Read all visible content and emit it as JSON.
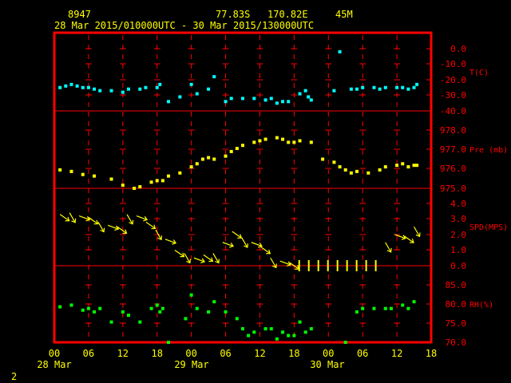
{
  "header": {
    "station": "8947",
    "lat": "77.83S",
    "lon": "170.82E",
    "elev": "45M",
    "period": "28 Mar 2015/010000UTC - 30 Mar 2015/130000UTC"
  },
  "footer": {
    "page_number": "2"
  },
  "colors": {
    "frame": "#ff0000",
    "axis_text": "#ff0000",
    "title_text": "#ffff00",
    "temperature": "#00ffff",
    "pressure": "#ffff00",
    "wind": "#ffff00",
    "humidity": "#00ff00",
    "x_labels": "#ffff00"
  },
  "chart_data": {
    "type": "scatter",
    "x_axis": {
      "tick_labels": [
        "00",
        "06",
        "12",
        "18",
        "00",
        "06",
        "12",
        "18",
        "00",
        "06",
        "12",
        "18"
      ],
      "day_labels": [
        "28 Mar",
        "29 Mar",
        "30 Mar"
      ],
      "range_hours": [
        0,
        66
      ]
    },
    "panels": [
      {
        "id": "temperature",
        "label": "T(C)",
        "tick_labels": [
          "0.0",
          "-10.0",
          "-20.0",
          "-30.0",
          "-40.0"
        ],
        "ylim": [
          -40,
          0
        ],
        "series": {
          "x": [
            1,
            2,
            3,
            4,
            5,
            6,
            7,
            8,
            10,
            12,
            13,
            15,
            16,
            18,
            18.5,
            20,
            22,
            24,
            25,
            27,
            28,
            30,
            31,
            33,
            35,
            37,
            38,
            39,
            40,
            41,
            43,
            44,
            44.5,
            45,
            49,
            50,
            52,
            53,
            54,
            56,
            57,
            58,
            60,
            61,
            62,
            63,
            63.5
          ],
          "y": [
            -25,
            -24,
            -23,
            -24,
            -25,
            -25,
            -26,
            -27,
            -27,
            -28,
            -26,
            -26,
            -25,
            -25,
            -23,
            -34,
            -31,
            -23,
            -29,
            -26,
            -18,
            -34,
            -32,
            -32,
            -32,
            -33,
            -32,
            -35,
            -34,
            -34,
            -29,
            -27,
            -31,
            -33,
            -27,
            -2,
            -26,
            -26,
            -25,
            -25,
            -26,
            -25,
            -25,
            -25,
            -26,
            -25,
            -23,
            -23,
            -24
          ]
        }
      },
      {
        "id": "pressure",
        "label": "Pre (mb)",
        "tick_labels": [
          "978.0",
          "977.0",
          "976.0",
          "975.0"
        ],
        "ylim": [
          975.0,
          978.8
        ],
        "series": {
          "x": [
            1,
            3,
            5,
            7,
            10,
            12,
            14,
            15,
            17,
            18,
            19,
            20,
            22,
            24,
            25,
            26,
            27,
            28,
            30,
            31,
            32,
            33,
            35,
            36,
            37,
            39,
            40,
            41,
            42,
            43,
            45,
            47,
            49,
            50,
            51,
            52,
            53,
            55,
            57,
            58,
            60,
            61,
            62,
            63,
            63.5
          ],
          "y": [
            976.2,
            976.1,
            975.9,
            975.8,
            975.6,
            975.2,
            975.0,
            975.1,
            975.4,
            975.5,
            975.5,
            975.8,
            976.0,
            976.4,
            976.6,
            976.9,
            977.0,
            976.9,
            977.1,
            977.4,
            977.6,
            977.8,
            978.0,
            978.1,
            978.2,
            978.3,
            978.2,
            978.0,
            978.0,
            978.1,
            978.0,
            976.9,
            976.7,
            976.4,
            976.2,
            976.0,
            976.1,
            976.0,
            976.2,
            976.4,
            976.5,
            976.6,
            976.4,
            976.5,
            976.5
          ]
        }
      },
      {
        "id": "wind",
        "label": "SPD(MPS)",
        "tick_labels": [
          "4.0",
          "3.0",
          "2.0",
          "1.0",
          "0.0"
        ],
        "ylim": [
          0,
          4.0
        ],
        "speeds": [
          3.3,
          3.4,
          3.2,
          3.1,
          2.8,
          2.6,
          2.5,
          3.3,
          3.2,
          2.8,
          2.3,
          1.7,
          1.0,
          0.8,
          0.5,
          0.7,
          0.8,
          1.5,
          2.2,
          1.8,
          1.5,
          1.2,
          0.5,
          0.3,
          0.2,
          0.0,
          0.0,
          0.0,
          0.0,
          0.0,
          0.0,
          0.0,
          0.0,
          0.0,
          1.5,
          2.0,
          1.9,
          2.5
        ]
      },
      {
        "id": "humidity",
        "label": "RH(%)",
        "tick_labels": [
          "85.0",
          "80.0",
          "75.0",
          "70.0"
        ],
        "ylim": [
          70.0,
          87.0
        ],
        "series": {
          "x": [
            1,
            3,
            5,
            6,
            7,
            8,
            10,
            12,
            13,
            15,
            17,
            18,
            18.5,
            19,
            20,
            23,
            24,
            25,
            27,
            28,
            30,
            32,
            33,
            34,
            35,
            37,
            38,
            39,
            40,
            41,
            42,
            43,
            44,
            45,
            51,
            53,
            54,
            56,
            58,
            59,
            61,
            62,
            63
          ],
          "y": [
            80.5,
            81,
            79.5,
            80,
            79,
            80,
            76,
            79,
            78,
            76,
            80,
            81,
            79,
            80,
            70,
            77,
            84,
            80,
            79,
            82,
            79,
            77,
            74,
            72,
            73,
            74,
            74,
            71,
            73,
            72,
            72,
            76,
            73,
            74,
            70,
            79,
            80,
            80,
            80,
            80,
            81,
            80,
            82
          ]
        }
      }
    ],
    "grid": true
  }
}
